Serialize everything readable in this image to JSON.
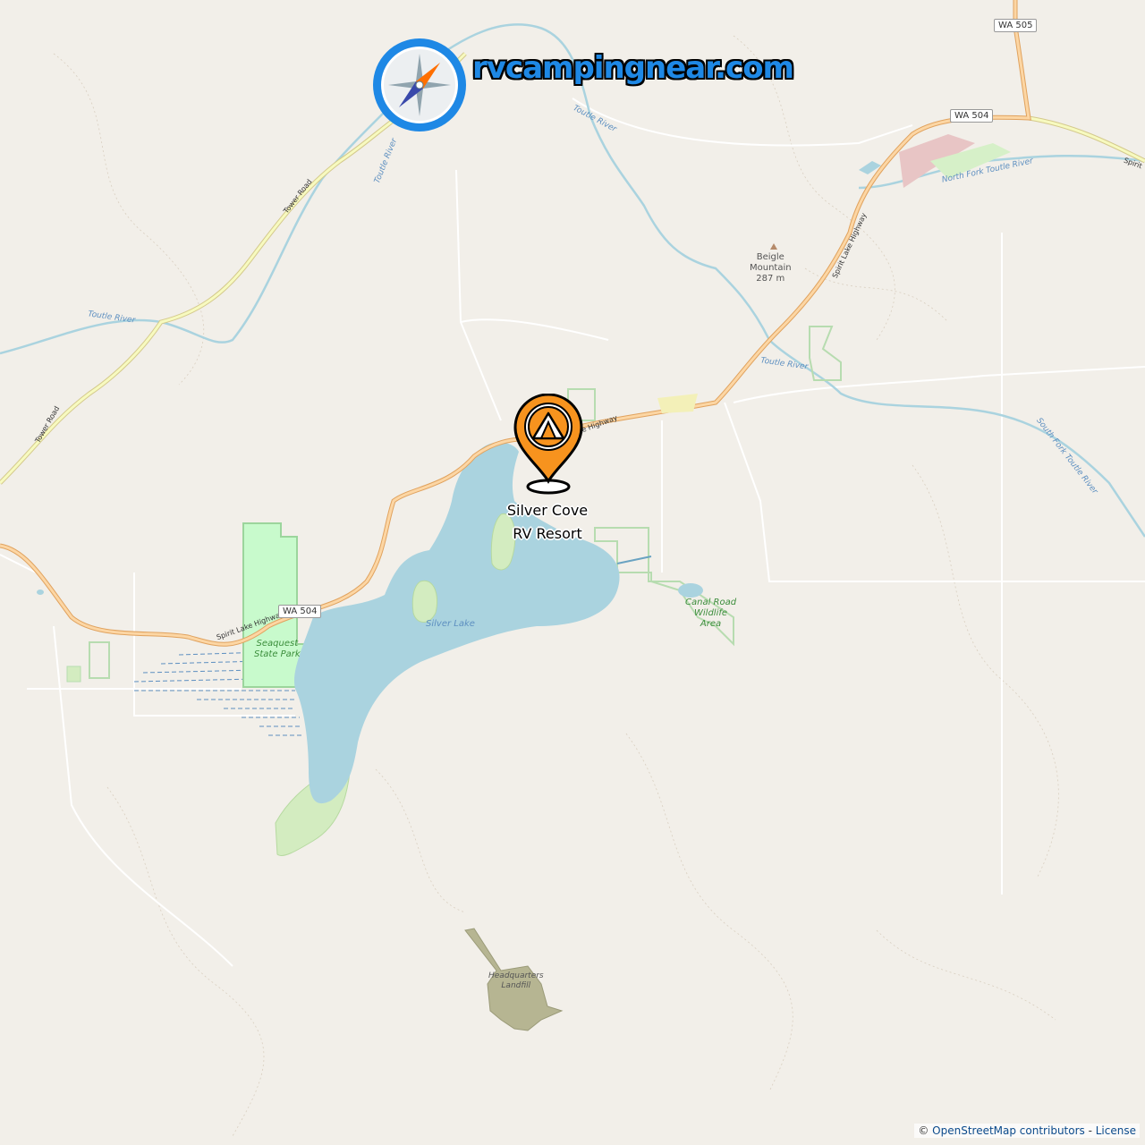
{
  "site": {
    "brand": "rvcampingnear.com"
  },
  "marker": {
    "title": "Silver Cove RV Resort",
    "icon": "campground-pin-icon",
    "color": "#f7931e"
  },
  "labels": {
    "silver_lake": "Silver Lake",
    "seaquest": [
      "Seaquest",
      "State Park"
    ],
    "canal_road": [
      "Canal Road",
      "Wildlife",
      "Area"
    ],
    "beigle": [
      "Beigle",
      "Mountain",
      "287 m"
    ],
    "landfill": [
      "Headquarters",
      "Landfill"
    ],
    "toutle_river": "Toutle River",
    "north_fork": "North Fork Toutle River",
    "south_fork": "South Fork Toutle River",
    "tower_road": "Tower Road",
    "spirit_lake_hwy": "Spirit Lake Highway",
    "spirit_lake_hwy_partial": "ke Highway",
    "spirit_edge": "Spirit"
  },
  "shields": {
    "wa504": "WA 504",
    "wa505": "WA 505"
  },
  "attribution": {
    "copy": "©",
    "osm": "OpenStreetMap contributors",
    "sep": " - ",
    "license": "License"
  },
  "colors": {
    "water": "#aad3df",
    "park": "#c8facc",
    "road_primary": "#fcd6a4",
    "road_secondary": "#f7fabf",
    "landfill": "#b6b592",
    "brand": "#1e88e5"
  }
}
